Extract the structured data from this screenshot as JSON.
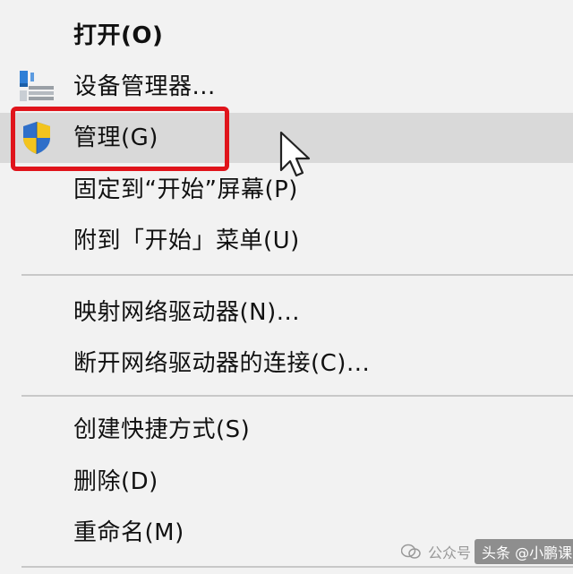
{
  "menu": {
    "items": [
      {
        "label": "打开(O)",
        "bold": true
      },
      {
        "label": "设备管理器...",
        "icon": "device-manager-icon"
      },
      {
        "label": "管理(G)",
        "icon": "uac-shield-icon",
        "state": "hovered"
      },
      {
        "label": "固定到“开始”屏幕(P)"
      },
      {
        "label": "附到「开始」菜单(U)"
      },
      {
        "label": "映射网络驱动器(N)..."
      },
      {
        "label": "断开网络驱动器的连接(C)..."
      },
      {
        "label": "创建快捷方式(S)"
      },
      {
        "label": "删除(D)"
      },
      {
        "label": "重命名(M)"
      }
    ]
  },
  "annotation": {
    "highlight_color": "#e0141b",
    "target": "管理(G)"
  },
  "cursor": {
    "icon": "mouse-pointer-icon"
  },
  "watermark": {
    "publisher": "公众号",
    "text": "头条 @小鹏课堂"
  },
  "colors": {
    "menu_background": "#f2f2f2",
    "hover_background": "#d9d9d9",
    "separator": "#c8c8c8"
  }
}
